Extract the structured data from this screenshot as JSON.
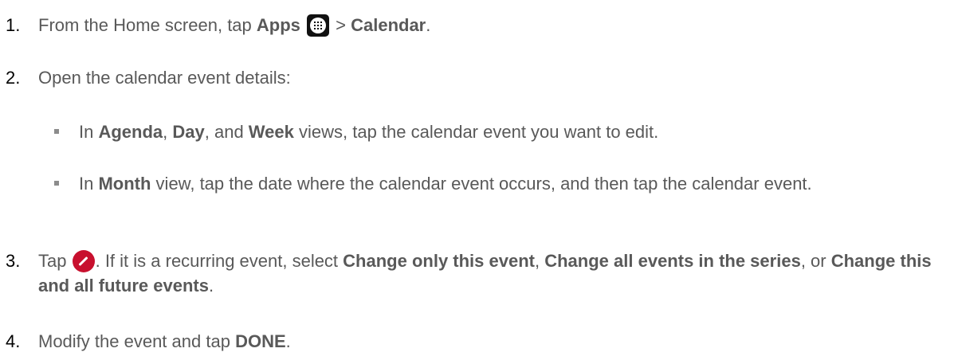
{
  "steps": [
    {
      "number": "1.",
      "parts": [
        "From the Home screen, tap ",
        "Apps",
        " > ",
        "Calendar",
        "."
      ]
    },
    {
      "number": "2.",
      "text": "Open the calendar event details:",
      "bullets": [
        {
          "parts": [
            "In ",
            "Agenda",
            ", ",
            "Day",
            ", and ",
            "Week",
            " views, tap the calendar event you want to edit."
          ]
        },
        {
          "parts": [
            "In ",
            "Month",
            " view, tap the date where the calendar event occurs, and then tap the calendar event."
          ]
        }
      ]
    },
    {
      "number": "3.",
      "parts": [
        "Tap ",
        ". If it is a recurring event, select ",
        "Change only this event",
        ", ",
        "Change all events in the series",
        ", or ",
        "Change this and all future events",
        "."
      ]
    },
    {
      "number": "4.",
      "parts": [
        "Modify the event and tap ",
        "DONE",
        "."
      ]
    }
  ],
  "icons": {
    "apps": "apps-grid-icon",
    "edit": "edit-pencil-icon",
    "edit_color": "#c8102e"
  }
}
